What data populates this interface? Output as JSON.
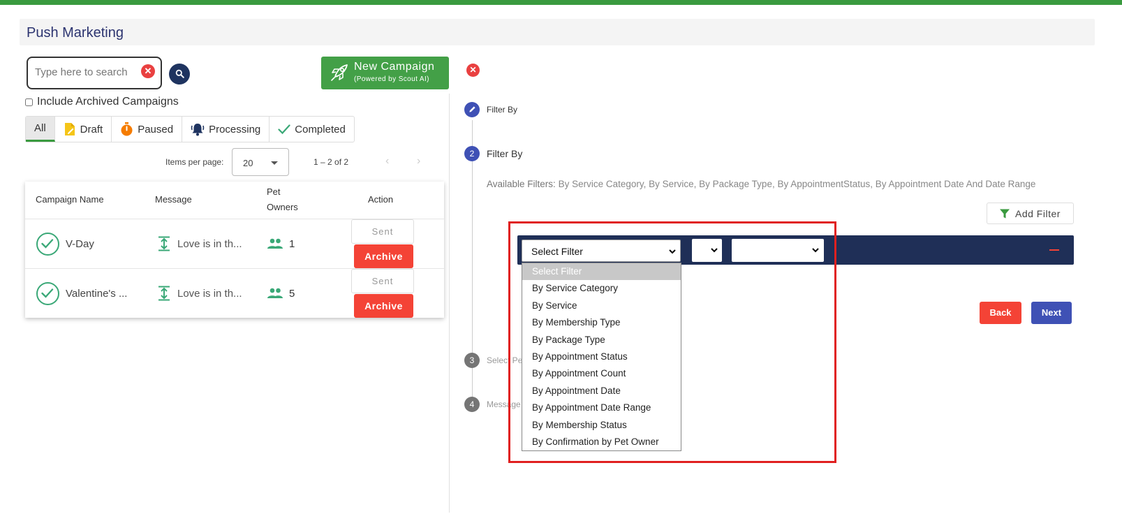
{
  "page": {
    "title": "Push Marketing"
  },
  "search": {
    "placeholder": "Type here to search"
  },
  "new_campaign": {
    "title": "New Campaign",
    "subtitle": "(Powered by Scout AI)"
  },
  "archived_checkbox": {
    "label": "Include Archived Campaigns",
    "checked": false
  },
  "status_tabs": [
    {
      "label": "All",
      "icon": "none",
      "active": true
    },
    {
      "label": "Draft",
      "icon": "draft-icon"
    },
    {
      "label": "Paused",
      "icon": "timer-icon"
    },
    {
      "label": "Processing",
      "icon": "bell-icon"
    },
    {
      "label": "Completed",
      "icon": "check-icon"
    }
  ],
  "pager": {
    "label": "Items per page:",
    "per_page": "20",
    "range": "1 – 2 of 2"
  },
  "table": {
    "headers": {
      "name": "Campaign Name",
      "message": "Message",
      "pet_owners_1": "Pet",
      "pet_owners_2": "Owners",
      "action": "Action"
    },
    "rows": [
      {
        "name": "V-Day",
        "message": "Love is in th...",
        "pet_owners": "1",
        "sent_label": "Sent",
        "archive_label": "Archive"
      },
      {
        "name": "Valentine's ...",
        "message": "Love is in th...",
        "pet_owners": "5",
        "sent_label": "Sent",
        "archive_label": "Archive"
      }
    ]
  },
  "stepper": {
    "steps": [
      {
        "number": "",
        "icon": "pencil-icon",
        "label": "Filter By"
      },
      {
        "number": "2",
        "label": "Filter By"
      },
      {
        "number": "3",
        "label": "Select Pe"
      },
      {
        "number": "4",
        "label": "Message"
      }
    ]
  },
  "filters": {
    "available_label": "Available Filters:",
    "available_values": "By Service Category, By Service, By Package Type, By AppointmentStatus, By Appointment Date And Date Range",
    "add_filter_label": "Add Filter",
    "select_value": "Select Filter",
    "options": [
      "Select Filter",
      "By Service Category",
      "By Service",
      "By Membership Type",
      "By Package Type",
      "By Appointment Status",
      "By Appointment Count",
      "By Appointment Date",
      "By Appointment Date Range",
      "By Membership Status",
      "By Confirmation by Pet Owner"
    ]
  },
  "nav_buttons": {
    "back": "Back",
    "next": "Next"
  },
  "colors": {
    "accent_green": "#43a047",
    "danger_red": "#f44336",
    "primary_blue": "#3f51b5",
    "navy": "#1f2f57"
  }
}
